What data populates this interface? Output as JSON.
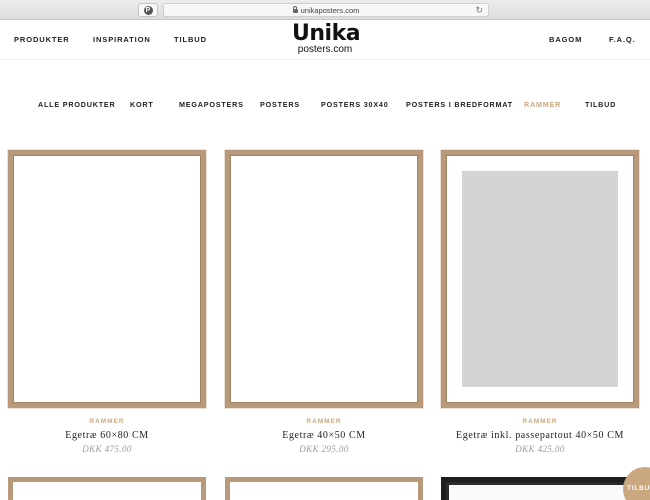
{
  "browser": {
    "url": "unikaposters.com",
    "pin_icon": "pinterest-icon"
  },
  "header": {
    "left_links": [
      "PRODUKTER",
      "INSPIRATION",
      "TILBUD"
    ],
    "right_links": [
      "BAGOM",
      "F.A.Q."
    ],
    "logo_main": "Unika",
    "logo_sub": "posters.com"
  },
  "categories": [
    {
      "label": "ALLE PRODUKTER"
    },
    {
      "label": "KORT"
    },
    {
      "label": "MEGAPOSTERS"
    },
    {
      "label": "POSTERS"
    },
    {
      "label": "POSTERS 30X40"
    },
    {
      "label": "POSTERS I BREDFORMAT"
    },
    {
      "label": "RAMMER",
      "active": true
    },
    {
      "label": "TILBUD"
    }
  ],
  "products": [
    {
      "category": "RAMMER",
      "name": "Egetræ 60×80 CM",
      "price": "DKK 475.00",
      "passepartout": false
    },
    {
      "category": "RAMMER",
      "name": "Egetræ 40×50 CM",
      "price": "DKK 295.00",
      "passepartout": false
    },
    {
      "category": "RAMMER",
      "name": "Egetræ inkl. passepartout 40×50 CM",
      "price": "DKK 425.00",
      "passepartout": true
    }
  ],
  "badge": {
    "label": "TILBUD"
  },
  "colors": {
    "accent": "#c9a880",
    "frame_oak": "#b89a7a",
    "frame_black": "#1d1d1d"
  }
}
